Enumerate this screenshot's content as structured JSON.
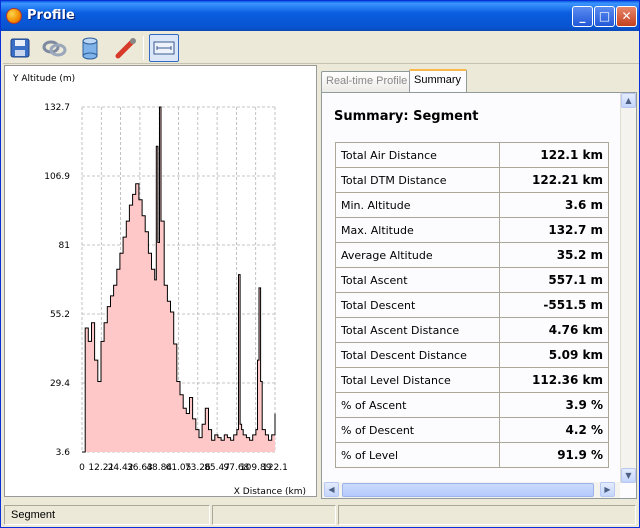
{
  "window": {
    "title": "Profile"
  },
  "titlebar_buttons": {
    "minimize": "_",
    "maximize": "□",
    "close": "✕"
  },
  "toolbar": {
    "tools": [
      {
        "name": "save-icon"
      },
      {
        "name": "link-icon"
      },
      {
        "name": "database-icon"
      },
      {
        "name": "pipette-icon"
      },
      {
        "name": "ruler-icon",
        "active": true
      }
    ]
  },
  "chart_data": {
    "type": "area",
    "ylabel": "Y Altitude (m)",
    "xlabel": "X Distance (km)",
    "ylim": [
      3.6,
      132.7
    ],
    "xlim": [
      0,
      122.1
    ],
    "yticks": [
      "132.7",
      "106.9",
      "81",
      "55.2",
      "29.4",
      "3.6"
    ],
    "xticks": [
      "0",
      "12.21",
      "24.42",
      "36.63",
      "48.84",
      "61.05",
      "73.26",
      "85.47",
      "97.68",
      "109.89",
      "122.1"
    ],
    "grid": true,
    "x": [
      0,
      2,
      4,
      6,
      8,
      10,
      12,
      14,
      16,
      18,
      20,
      22,
      24,
      26,
      28,
      30,
      32,
      34,
      36,
      38,
      40,
      42,
      44,
      46,
      47,
      48,
      49,
      50,
      52,
      54,
      56,
      58,
      60,
      62,
      64,
      66,
      68,
      70,
      72,
      74,
      76,
      78,
      80,
      82,
      84,
      86,
      88,
      90,
      92,
      94,
      96,
      98,
      99,
      100,
      101,
      102,
      104,
      106,
      108,
      110,
      111,
      112,
      113,
      114,
      116,
      118,
      120,
      122.1
    ],
    "values": [
      3.6,
      50,
      45,
      52,
      38,
      30,
      45,
      52,
      58,
      62,
      66,
      72,
      78,
      84,
      90,
      96,
      100,
      104,
      98,
      92,
      86,
      78,
      72,
      68,
      118,
      82,
      132.7,
      90,
      66,
      60,
      56,
      44,
      30,
      25,
      20,
      18,
      24,
      16,
      12,
      9,
      14,
      20,
      12,
      8,
      10,
      9,
      8,
      10,
      9,
      8,
      10,
      12,
      70,
      14,
      12,
      10,
      9,
      8,
      10,
      12,
      38,
      65,
      30,
      12,
      10,
      8,
      10,
      18
    ]
  },
  "tabs": [
    {
      "label": "Real-time Profile",
      "selected": false
    },
    {
      "label": "Summary",
      "selected": true
    }
  ],
  "summary": {
    "title": "Summary: Segment",
    "rows": [
      {
        "label": "Total Air Distance",
        "value": "122.1 km"
      },
      {
        "label": "Total DTM Distance",
        "value": "122.21 km"
      },
      {
        "label": "Min. Altitude",
        "value": "3.6 m"
      },
      {
        "label": "Max. Altitude",
        "value": "132.7 m"
      },
      {
        "label": "Average Altitude",
        "value": "35.2 m"
      },
      {
        "label": "Total Ascent",
        "value": "557.1 m"
      },
      {
        "label": "Total Descent",
        "value": "-551.5 m"
      },
      {
        "label": "Total Ascent Distance",
        "value": "4.76 km"
      },
      {
        "label": "Total Descent Distance",
        "value": "5.09 km"
      },
      {
        "label": "Total Level Distance",
        "value": "112.36 km"
      },
      {
        "label": "% of Ascent",
        "value": "3.9 %"
      },
      {
        "label": "% of Descent",
        "value": "4.2 %"
      },
      {
        "label": "% of Level",
        "value": "91.9 %"
      }
    ]
  },
  "statusbar": {
    "text": "Segment"
  },
  "colors": {
    "area_fill": "#ffc8c8",
    "line": "#000000",
    "grid": "#b4b4b4",
    "title_bar": "#0a5ee0"
  }
}
